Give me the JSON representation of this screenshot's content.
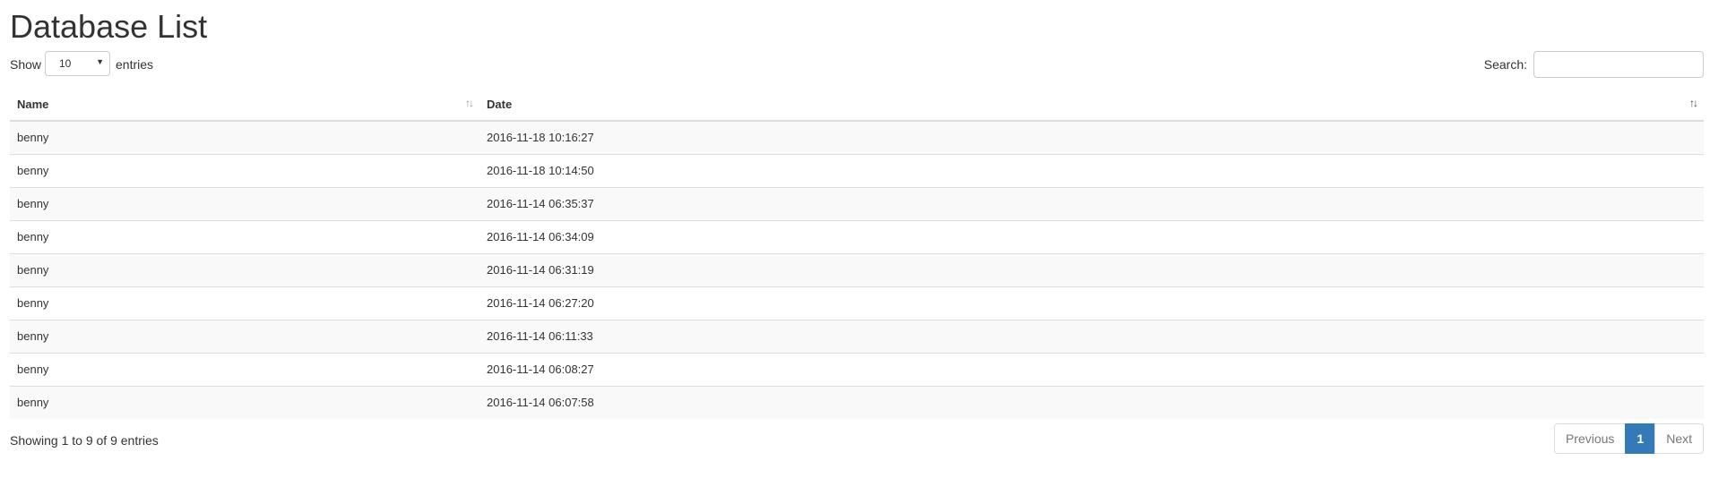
{
  "page_title": "Database List",
  "controls": {
    "show_label": "Show",
    "page_length": "10",
    "entries_label": "entries",
    "search_label": "Search:",
    "search_value": ""
  },
  "table": {
    "columns": [
      "Name",
      "Date"
    ],
    "rows": [
      [
        "benny",
        "2016-11-18 10:16:27"
      ],
      [
        "benny",
        "2016-11-18 10:14:50"
      ],
      [
        "benny",
        "2016-11-14 06:35:37"
      ],
      [
        "benny",
        "2016-11-14 06:34:09"
      ],
      [
        "benny",
        "2016-11-14 06:31:19"
      ],
      [
        "benny",
        "2016-11-14 06:27:20"
      ],
      [
        "benny",
        "2016-11-14 06:11:33"
      ],
      [
        "benny",
        "2016-11-14 06:08:27"
      ],
      [
        "benny",
        "2016-11-14 06:07:58"
      ]
    ]
  },
  "footer": {
    "info": "Showing 1 to 9 of 9 entries",
    "previous": "Previous",
    "current_page": "1",
    "next": "Next"
  },
  "colors": {
    "accent": "#337ab7",
    "stripe": "#f9f9f9",
    "border": "#dddddd"
  }
}
